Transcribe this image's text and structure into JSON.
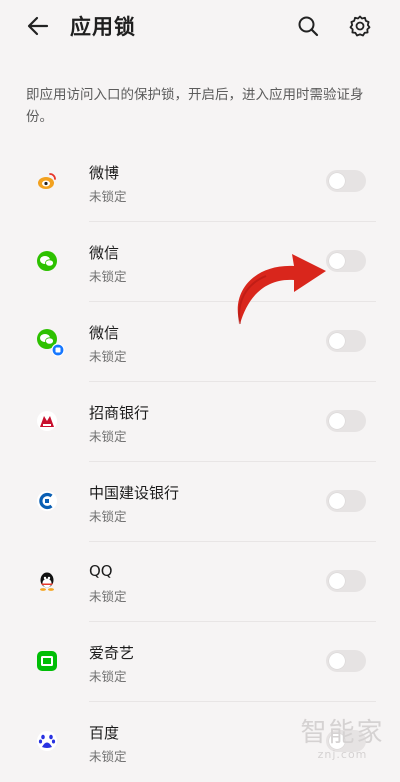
{
  "header": {
    "title": "应用锁",
    "back_icon": "back-arrow-icon",
    "search_icon": "search-icon",
    "settings_icon": "gear-icon"
  },
  "description": "即应用访问入口的保护锁，开启后，进入应用时需验证身份。",
  "apps": [
    {
      "name": "微博",
      "status": "未锁定",
      "icon": "weibo-icon",
      "color": "#f7a12b",
      "locked": false
    },
    {
      "name": "微信",
      "status": "未锁定",
      "icon": "wechat-icon",
      "color": "#2dc100",
      "locked": false
    },
    {
      "name": "微信",
      "status": "未锁定",
      "icon": "wechat-clone-icon",
      "color": "#2dc100",
      "locked": false
    },
    {
      "name": "招商银行",
      "status": "未锁定",
      "icon": "cmb-bank-icon",
      "color": "#c8102e",
      "locked": false
    },
    {
      "name": "中国建设银行",
      "status": "未锁定",
      "icon": "ccb-bank-icon",
      "color": "#0a5fb4",
      "locked": false
    },
    {
      "name": "QQ",
      "status": "未锁定",
      "icon": "qq-icon",
      "color": "#111111",
      "locked": false
    },
    {
      "name": "爱奇艺",
      "status": "未锁定",
      "icon": "iqiyi-icon",
      "color": "#00be06",
      "locked": false
    },
    {
      "name": "百度",
      "status": "未锁定",
      "icon": "baidu-icon",
      "color": "#2932e1",
      "locked": false
    }
  ],
  "annotation": {
    "icon": "red-curved-arrow-icon",
    "color": "#d9261c"
  },
  "watermark": {
    "big": "智能家",
    "small": "znj.com"
  }
}
